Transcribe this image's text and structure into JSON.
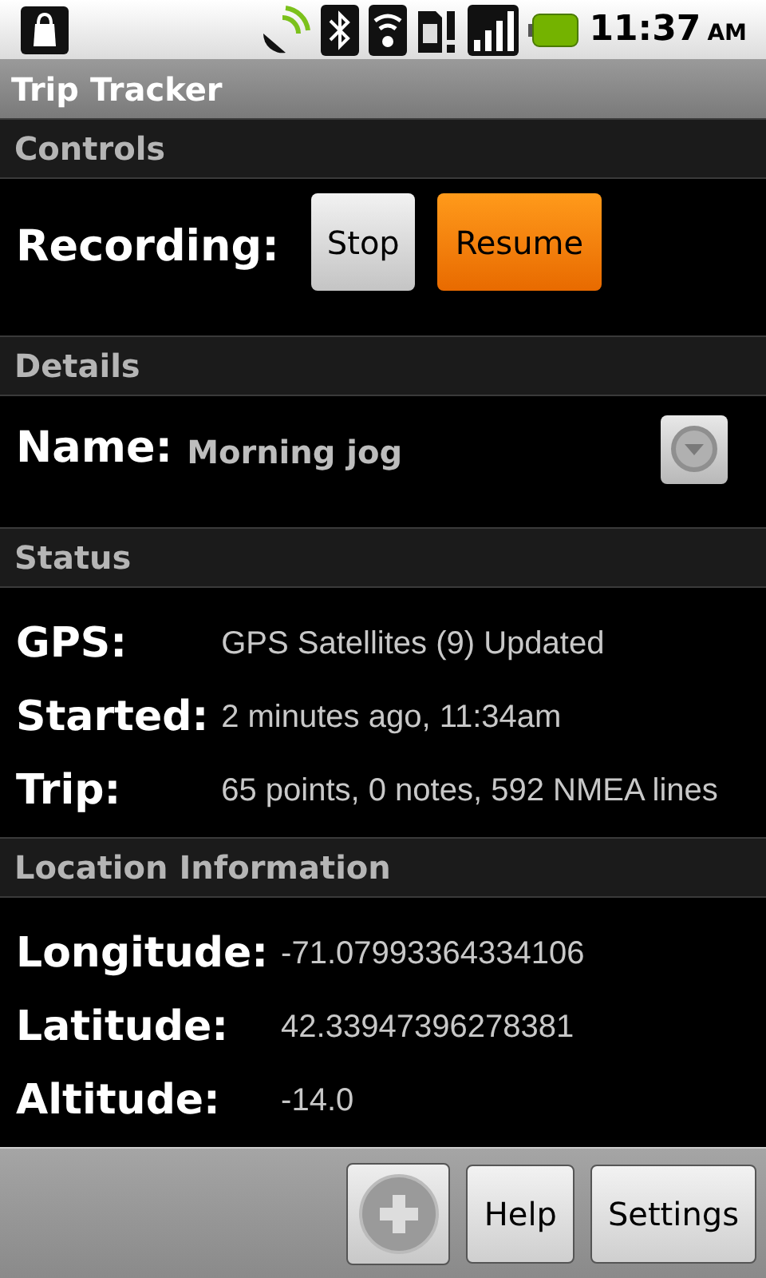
{
  "status_bar": {
    "time": "11:37",
    "ampm": "AM"
  },
  "window": {
    "title": "Trip Tracker"
  },
  "sections": [
    {
      "kind": "controls",
      "header": "Controls",
      "label": "Recording:",
      "buttons": [
        {
          "label": "Stop",
          "highlighted": false
        },
        {
          "label": "Resume",
          "highlighted": true
        }
      ]
    },
    {
      "kind": "name",
      "header": "Details",
      "label": "Name:",
      "value": "Morning jog"
    },
    {
      "kind": "rows",
      "header": "Status",
      "rows": [
        {
          "label": "GPS:",
          "value": "GPS Satellites (9) Updated"
        },
        {
          "label": "Started:",
          "value": "2 minutes ago, 11:34am"
        },
        {
          "label": "Trip:",
          "value": "65 points, 0 notes, 592 NMEA lines"
        }
      ]
    },
    {
      "kind": "rows",
      "header": "Location Information",
      "rows": [
        {
          "label": "Longitude:",
          "value": "-71.07993364334106"
        },
        {
          "label": "Latitude:",
          "value": "42.33947396278381"
        },
        {
          "label": "Altitude:",
          "value": "-14.0"
        }
      ]
    }
  ],
  "bottom_bar": {
    "buttons": [
      "Help",
      "Settings"
    ]
  }
}
